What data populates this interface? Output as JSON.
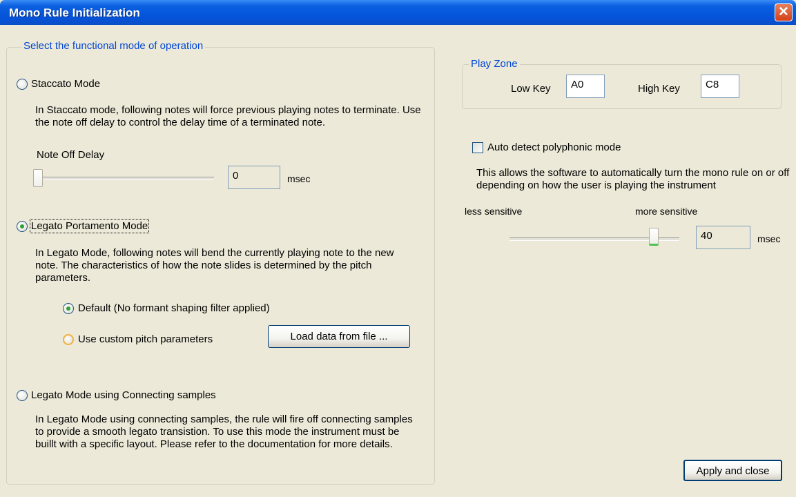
{
  "window": {
    "title": "Mono Rule Initialization",
    "close_glyph": "✕"
  },
  "mode_group": {
    "legend": "Select the functional mode of operation",
    "staccato": {
      "label": "Staccato Mode",
      "description": "In Staccato mode, following notes will force previous playing notes to terminate. Use the note off delay to control the delay time of a terminated note.",
      "delay_label": "Note Off Delay",
      "delay_value": "0",
      "delay_unit": "msec",
      "delay_slider_fraction": 0
    },
    "legato_portamento": {
      "label": "Legato Portamento Mode",
      "description": "In Legato Mode, following notes will bend the currently playing note to the new note. The characteristics of how the note slides is determined by the pitch parameters.",
      "default_option": "Default (No formant shaping filter applied)",
      "custom_option": "Use custom pitch parameters",
      "load_button": "Load data from file ..."
    },
    "legato_connecting": {
      "label": "Legato Mode using Connecting samples",
      "description": "In Legato Mode using connecting samples, the rule will fire off connecting samples to provide a smooth legato transistion. To use this mode the instrument must be buillt with a specific layout. Please refer to the documentation for more details."
    }
  },
  "play_zone": {
    "legend": "Play Zone",
    "low_key_label": "Low Key",
    "low_key_value": "A0",
    "high_key_label": "High Key",
    "high_key_value": "C8"
  },
  "polyphonic": {
    "checkbox_label": "Auto detect polyphonic mode",
    "description": "This allows the software to automatically turn the mono rule on or off depending on how the user is playing the instrument",
    "less_label": "less sensitive",
    "more_label": "more sensitive",
    "value": "40",
    "unit": "msec",
    "slider_fraction": 0.86
  },
  "apply_button": "Apply and close"
}
